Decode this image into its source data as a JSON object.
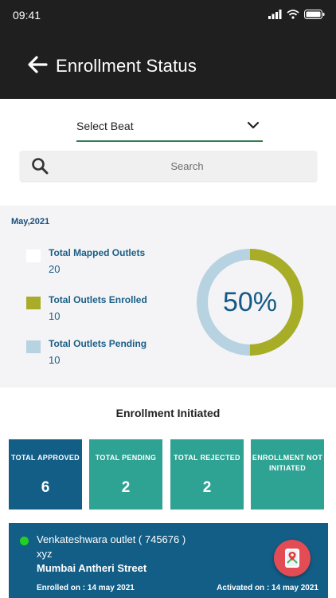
{
  "status_bar": {
    "time": "09:41"
  },
  "header": {
    "title": "Enrollment Status"
  },
  "beat_select": {
    "label": "Select Beat"
  },
  "search": {
    "placeholder": "Search"
  },
  "summary": {
    "month": "May,2021",
    "items": [
      {
        "label": "Total Mapped Outlets",
        "value": "20",
        "color": "#ffffff"
      },
      {
        "label": "Total Outlets Enrolled",
        "value": "10",
        "color": "#a8ad27"
      },
      {
        "label": "Total Outlets Pending",
        "value": "10",
        "color": "#b7d2e1"
      }
    ],
    "percent_label": "50%",
    "enrolled_fraction": 0.5
  },
  "enrollment": {
    "title": "Enrollment Initiated",
    "stats": [
      {
        "label": "TOTAL APPROVED",
        "value": "6",
        "color": "#135e87"
      },
      {
        "label": "TOTAL PENDING",
        "value": "2",
        "color": "#2ea293"
      },
      {
        "label": "TOTAL REJECTED",
        "value": "2",
        "color": "#2ea293"
      },
      {
        "label": "ENROLLMENT NOT INITIATED",
        "value": "",
        "color": "#2ea293"
      }
    ]
  },
  "outlet": {
    "name": "Venkateshwara outlet ( 745676 )",
    "owner": "xyz",
    "address": "Mumbai Antheri Street",
    "enrolled": "Enrolled on : 14 may 2021",
    "activated": "Activated on : 14 may 2021",
    "status_color": "#22d022"
  }
}
